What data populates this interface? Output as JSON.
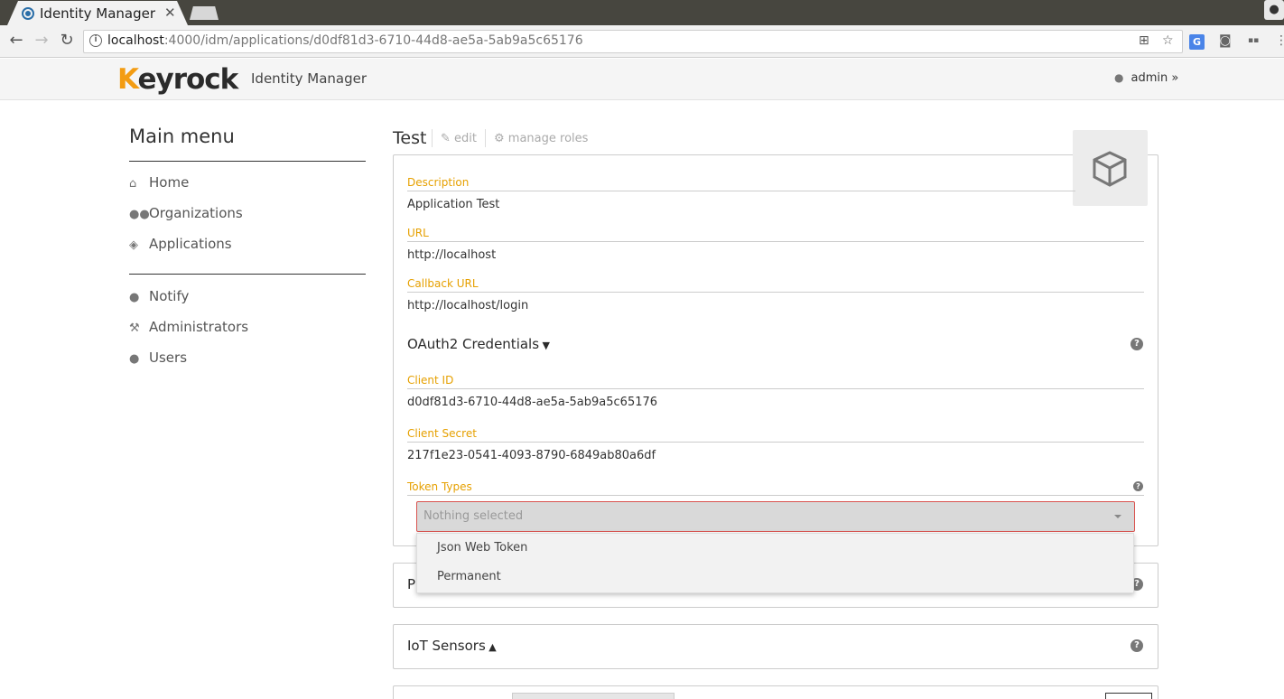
{
  "browser": {
    "tab_title": "Identity Manager",
    "tab_close": "✕",
    "url_host": "localhost",
    "url_path": ":4000/idm/applications/d0df81d3-6710-44d8-ae5a-5ab9a5c65176"
  },
  "header": {
    "logo_k": "K",
    "logo_rest": "eyrock",
    "subtitle": "Identity Manager",
    "user": "admin"
  },
  "sidebar": {
    "title": "Main menu",
    "items": [
      {
        "label": "Home",
        "icon": "home-icon"
      },
      {
        "label": "Organizations",
        "icon": "users-icon"
      },
      {
        "label": "Applications",
        "icon": "cube-icon"
      },
      {
        "label": "Notify",
        "icon": "comment-icon"
      },
      {
        "label": "Administrators",
        "icon": "wrench-icon"
      },
      {
        "label": "Users",
        "icon": "user-icon"
      }
    ]
  },
  "app": {
    "name": "Test",
    "edit_label": "edit",
    "manage_roles_label": "manage roles",
    "description_label": "Description",
    "description": "Application Test",
    "url_label": "URL",
    "url": "http://localhost",
    "callback_label": "Callback URL",
    "callback": "http://localhost/login"
  },
  "oauth": {
    "title": "OAuth2 Credentials",
    "client_id_label": "Client ID",
    "client_id": "d0df81d3-6710-44d8-ae5a-5ab9a5c65176",
    "client_secret_label": "Client Secret",
    "client_secret": "217f1e23-0541-4093-8790-6849ab80a6df",
    "token_types_label": "Token Types",
    "token_types_placeholder": "Nothing selected",
    "token_options": [
      "Json Web Token",
      "Permanent"
    ]
  },
  "sections": {
    "collapsed_initial": "P",
    "iot_sensors": "IoT Sensors"
  },
  "colors": {
    "label_accent": "#e6a000",
    "error_border": "#d9534f",
    "logo_accent": "#f39c12"
  }
}
